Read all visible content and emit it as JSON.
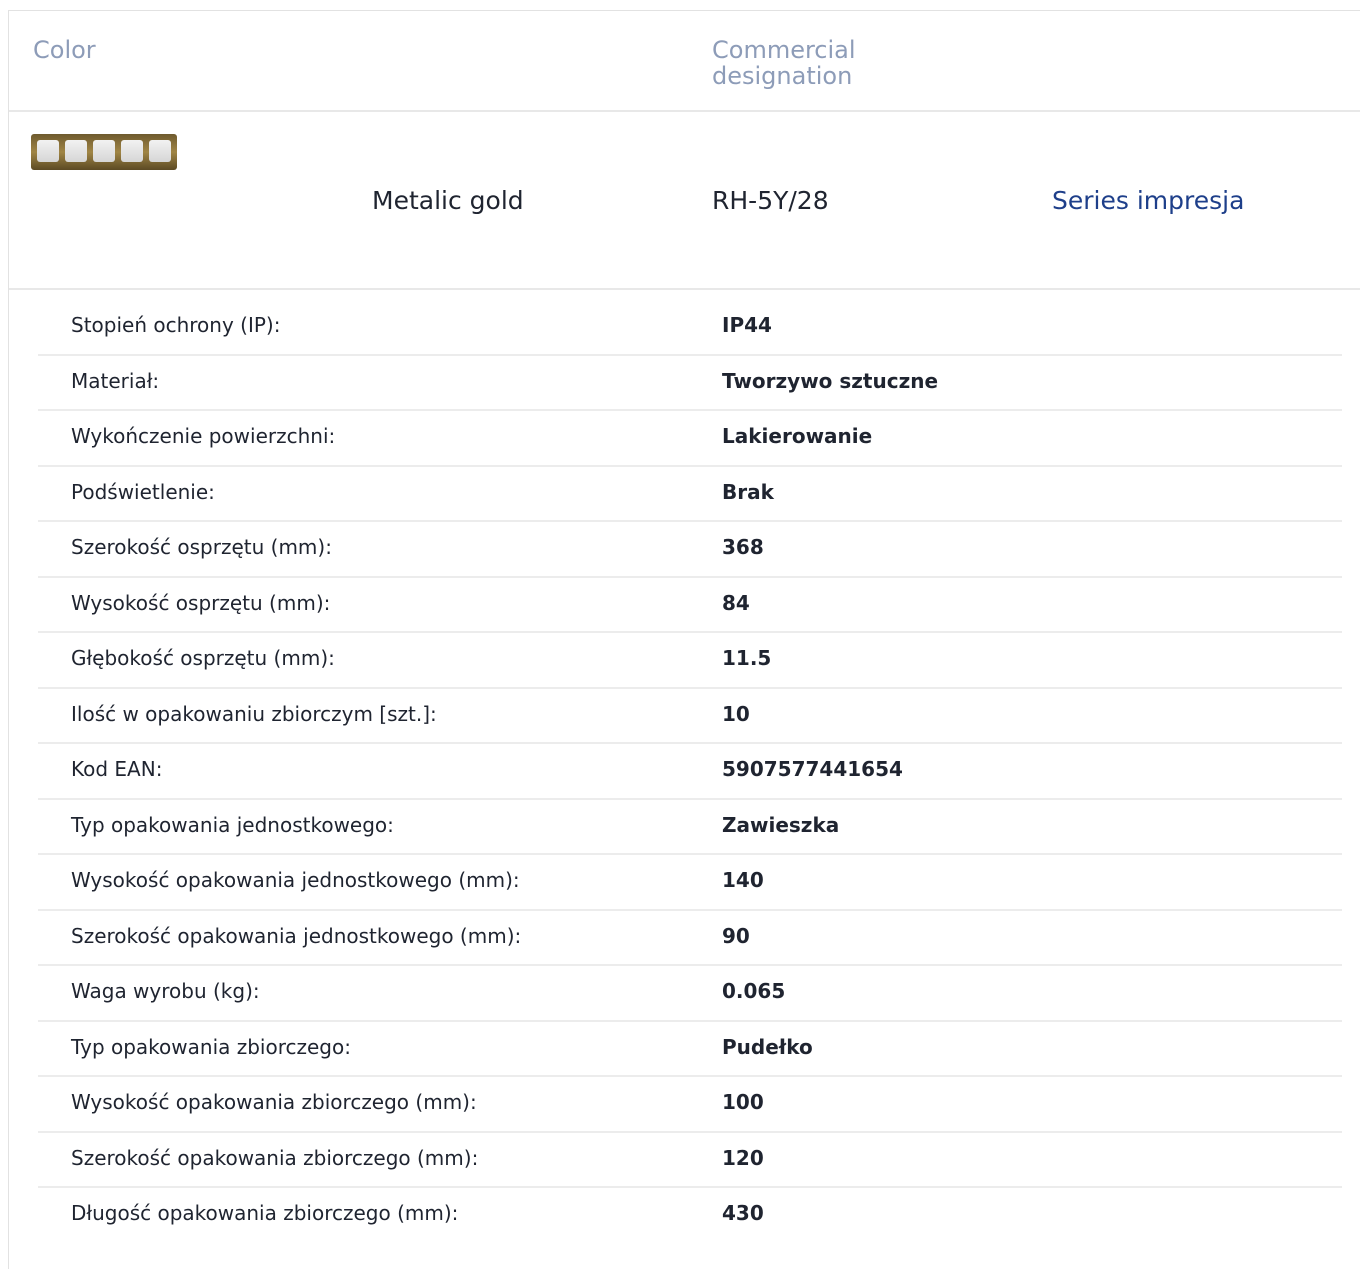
{
  "header": {
    "color_label": "Color",
    "commercial_label": "Commercial designation"
  },
  "product": {
    "thumbnail_icon": "gold-five-gang-frame-icon",
    "thumbnail_color": "#b59a5a",
    "color_name": "Metalic gold",
    "code": "RH-5Y/28",
    "series_link": "Series impresja",
    "series_link_color": "#1e3f8a"
  },
  "specs": [
    {
      "label": "Stopień ochrony (IP):",
      "value": "IP44"
    },
    {
      "label": "Materiał:",
      "value": "Tworzywo sztuczne"
    },
    {
      "label": "Wykończenie powierzchni:",
      "value": "Lakierowanie"
    },
    {
      "label": "Podświetlenie:",
      "value": "Brak"
    },
    {
      "label": "Szerokość osprzętu (mm):",
      "value": "368"
    },
    {
      "label": "Wysokość osprzętu (mm):",
      "value": "84"
    },
    {
      "label": "Głębokość osprzętu (mm):",
      "value": "11.5"
    },
    {
      "label": "Ilość w opakowaniu zbiorczym [szt.]:",
      "value": "10"
    },
    {
      "label": "Kod EAN:",
      "value": "5907577441654"
    },
    {
      "label": "Typ opakowania jednostkowego:",
      "value": "Zawieszka"
    },
    {
      "label": "Wysokość opakowania jednostkowego (mm):",
      "value": "140"
    },
    {
      "label": "Szerokość opakowania jednostkowego (mm):",
      "value": "90"
    },
    {
      "label": "Waga wyrobu (kg):",
      "value": "0.065"
    },
    {
      "label": "Typ opakowania zbiorczego:",
      "value": "Pudełko"
    },
    {
      "label": "Wysokość opakowania zbiorczego (mm):",
      "value": "100"
    },
    {
      "label": "Szerokość opakowania zbiorczego (mm):",
      "value": "120"
    },
    {
      "label": "Długość opakowania zbiorczego (mm):",
      "value": "430"
    }
  ]
}
